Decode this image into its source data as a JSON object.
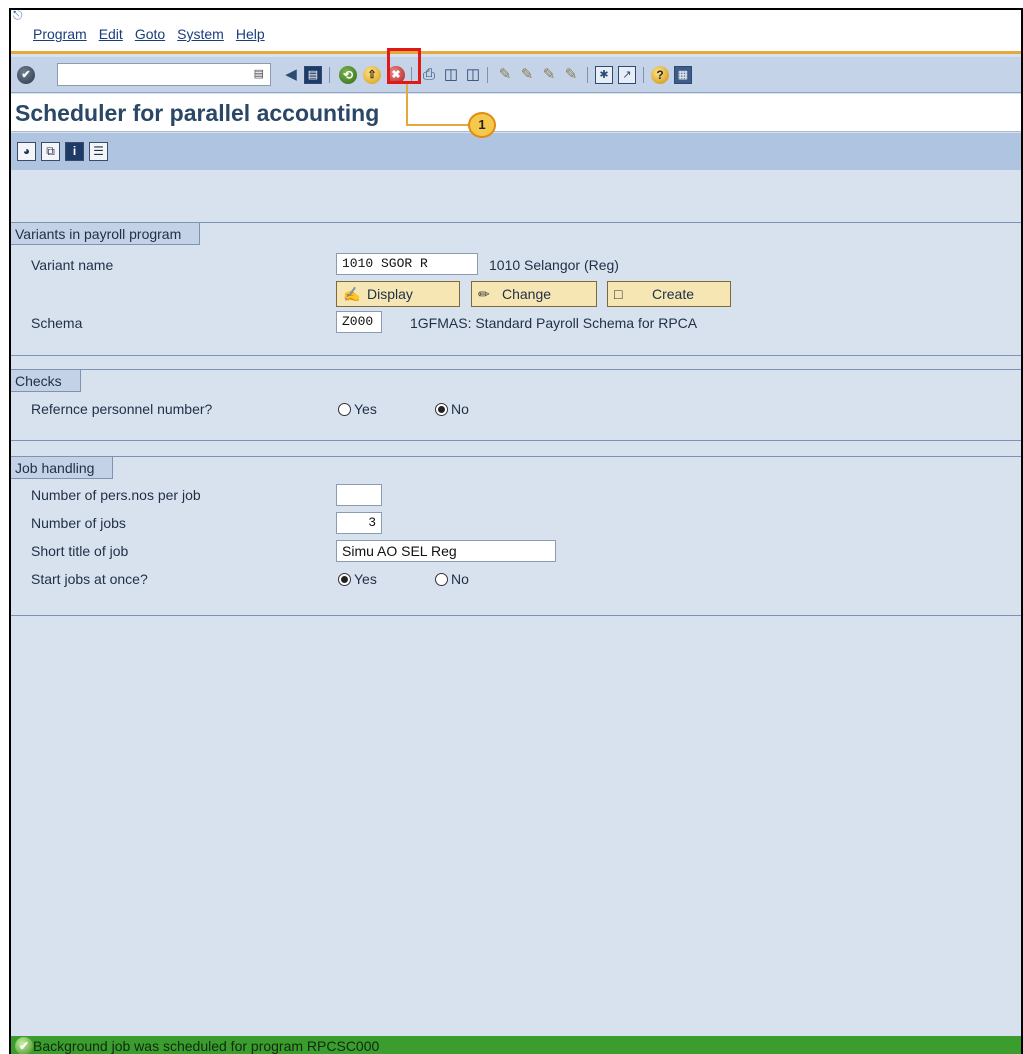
{
  "menu": [
    "Program",
    "Edit",
    "Goto",
    "System",
    "Help"
  ],
  "toolbar": {
    "command_value": "",
    "icons": [
      "enter-icon",
      "back-icon",
      "exit-icon",
      "cancel-icon",
      "save-icon",
      "print-icon",
      "find-icon",
      "find-next-icon",
      "first-page-icon",
      "previous-page-icon",
      "next-page-icon",
      "last-page-icon",
      "new-session-icon",
      "shortcut-icon",
      "help-icon",
      "layout-icon"
    ]
  },
  "callout": {
    "number": "1"
  },
  "title": "Scheduler for parallel accounting",
  "app_toolbar": {
    "icons": [
      "execute-icon",
      "copy-icon",
      "info-icon",
      "program-doc-icon"
    ]
  },
  "variants": {
    "heading": "Variants in payroll program",
    "variant_label": "Variant name",
    "variant_value": "1010 SGOR R",
    "variant_desc": "1010 Selangor (Reg)",
    "display_label": "Display",
    "change_label": "Change",
    "create_label": "Create",
    "schema_label": "Schema",
    "schema_value": "Z000",
    "schema_desc": "1GFMAS: Standard Payroll Schema for RPCA"
  },
  "checks": {
    "heading": "Checks",
    "ref_label": "Refernce personnel number?",
    "yes": "Yes",
    "no": "No",
    "selected": "No"
  },
  "job": {
    "heading": "Job handling",
    "persnos_label": "Number of pers.nos per job",
    "persnos_value": "",
    "jobs_label": "Number of jobs",
    "jobs_value": "3",
    "title_label": "Short title of job",
    "title_value": "Simu AO SEL Reg",
    "start_label": "Start jobs at once?",
    "yes": "Yes",
    "no": "No",
    "selected": "Yes"
  },
  "status": {
    "message": "Background job was scheduled for program RPCSC000"
  },
  "colors": {
    "accent": "#e5a83c",
    "status_bar": "#3a9d2d",
    "highlight": "#e01818"
  }
}
